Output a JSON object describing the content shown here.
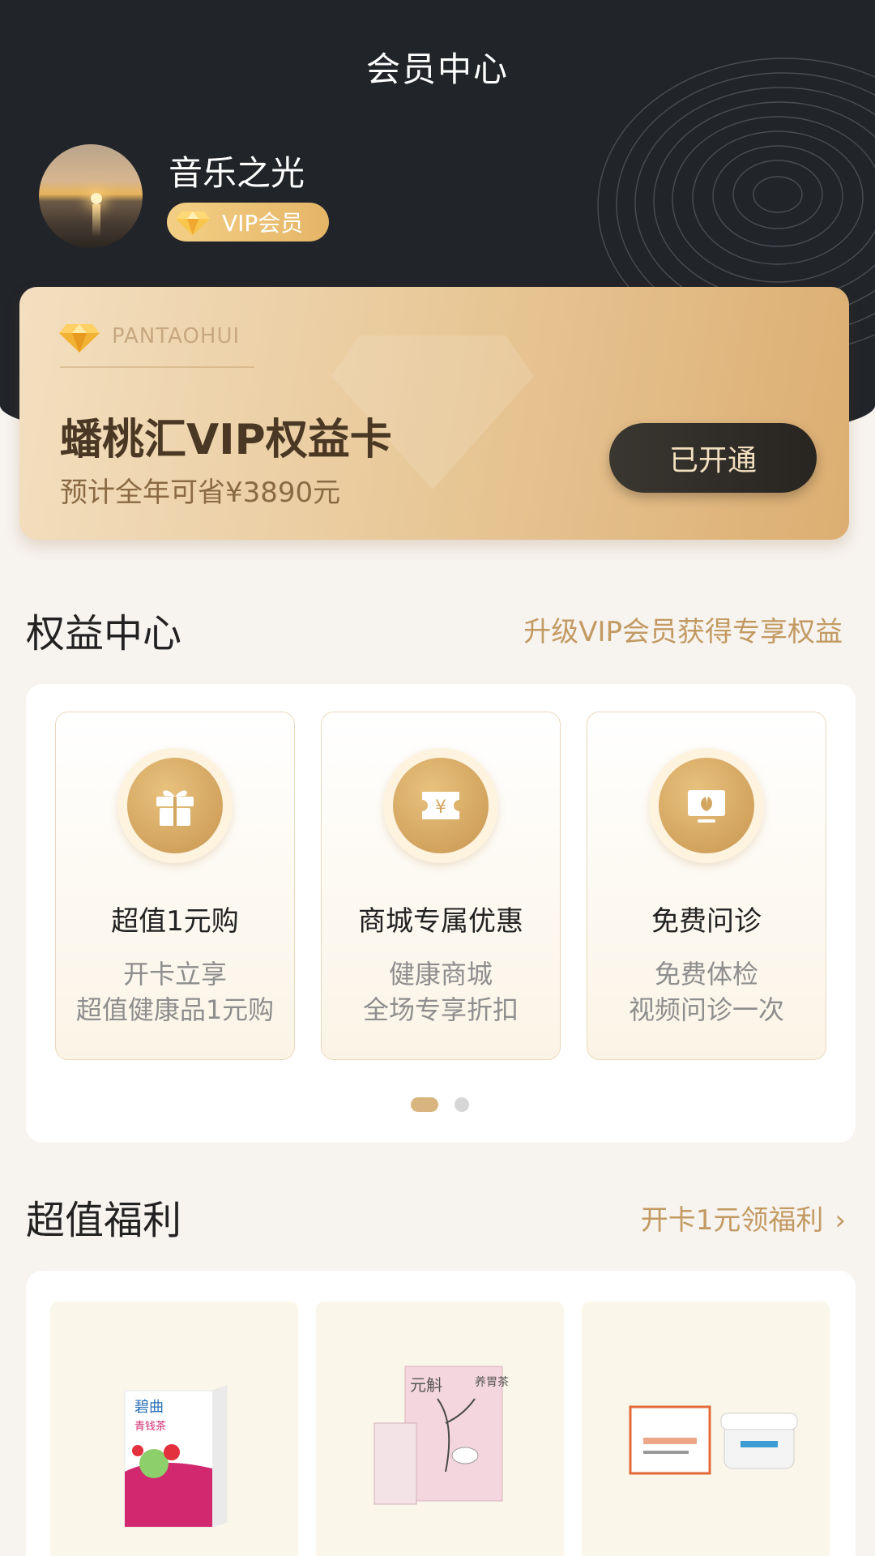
{
  "header": {
    "title": "会员中心"
  },
  "user": {
    "name": "音乐之光",
    "badge": "VIP会员"
  },
  "vip_card": {
    "brand": "PANTAOHUI",
    "title": "蟠桃汇VIP权益卡",
    "subtitle": "预计全年可省¥3890元",
    "button": "已开通"
  },
  "benefits": {
    "title": "权益中心",
    "link": "升级VIP会员获得专享权益",
    "items": [
      {
        "icon": "gift-icon",
        "title": "超值1元购",
        "line1": "开卡立享",
        "line2": "超值健康品1元购"
      },
      {
        "icon": "coupon-icon",
        "title": "商城专属优惠",
        "line1": "健康商城",
        "line2": "全场专享折扣"
      },
      {
        "icon": "consultation-icon",
        "title": "免费问诊",
        "line1": "免费体检",
        "line2": "视频问诊一次"
      }
    ],
    "pager": {
      "current": 1,
      "total": 2
    }
  },
  "welfare": {
    "title": "超值福利",
    "link": "开卡1元领福利",
    "products": [
      {
        "image": "tea-box-product-image",
        "box_text": "碧曲",
        "box_subtext": "青钱茶"
      },
      {
        "image": "herbal-tea-product-image",
        "box_text": "养胃茶",
        "box_subtext": "元斛"
      },
      {
        "image": "cream-product-image"
      }
    ]
  },
  "colors": {
    "header_bg": "#212429",
    "gold": "#c29a62",
    "card_gold": "#e8c898",
    "button_dark": "#2f2b26"
  }
}
